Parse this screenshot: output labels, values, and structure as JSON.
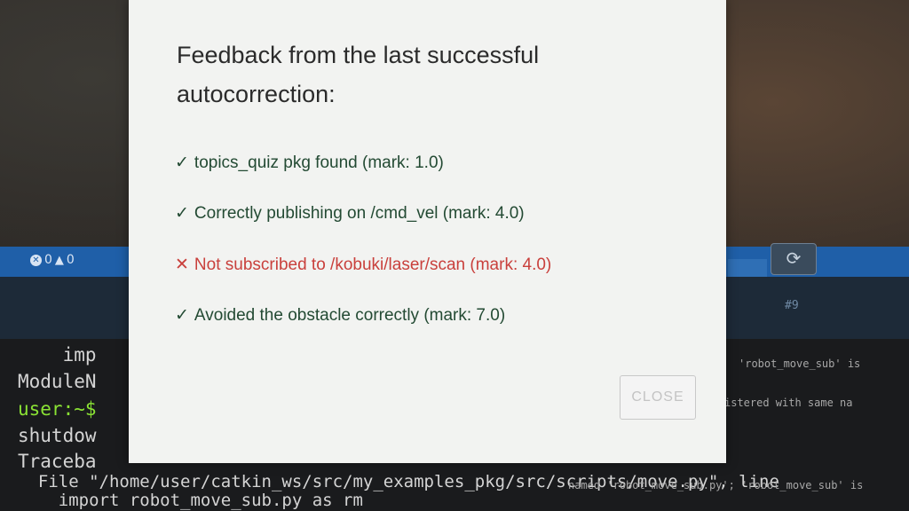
{
  "dialog": {
    "title": "Feedback from the last successful autocorrection:",
    "items": [
      {
        "icon": "check-icon",
        "status": "ok",
        "text": "topics_quiz pkg found (mark: 1.0)"
      },
      {
        "icon": "check-icon",
        "status": "ok",
        "text": "Correctly publishing on /cmd_vel (mark: 4.0)"
      },
      {
        "icon": "cross-icon",
        "status": "fail",
        "text": "Not subscribed to /kobuki/laser/scan (mark: 4.0)"
      },
      {
        "icon": "check-icon",
        "status": "ok",
        "text": "Avoided the obstacle correctly (mark: 7.0)"
      }
    ],
    "close_label": "CLOSE"
  },
  "statusbar": {
    "errors": "0",
    "warnings": "0",
    "refresh_icon": "refresh-icon",
    "num_label": "#9"
  },
  "terminal": {
    "lines": [
      "    imp",
      "ModuleN",
      "user:~$",
      "shutdow",
      "Traceba",
      "  File \"/home/user/catkin_ws/src/my_examples_pkg/src/scripts/move.py\", line",
      "    import robot_move_sub.py as rm"
    ],
    "right_fragments": [
      "'robot_move_sub' is",
      "istered with same na",
      "named 'robot_move_sub.py'; 'robot_move_sub' is"
    ]
  },
  "colors": {
    "statusbar": "#1f5fa8",
    "ok": "#234a33",
    "fail": "#c9403c",
    "prompt": "#8ae234"
  }
}
